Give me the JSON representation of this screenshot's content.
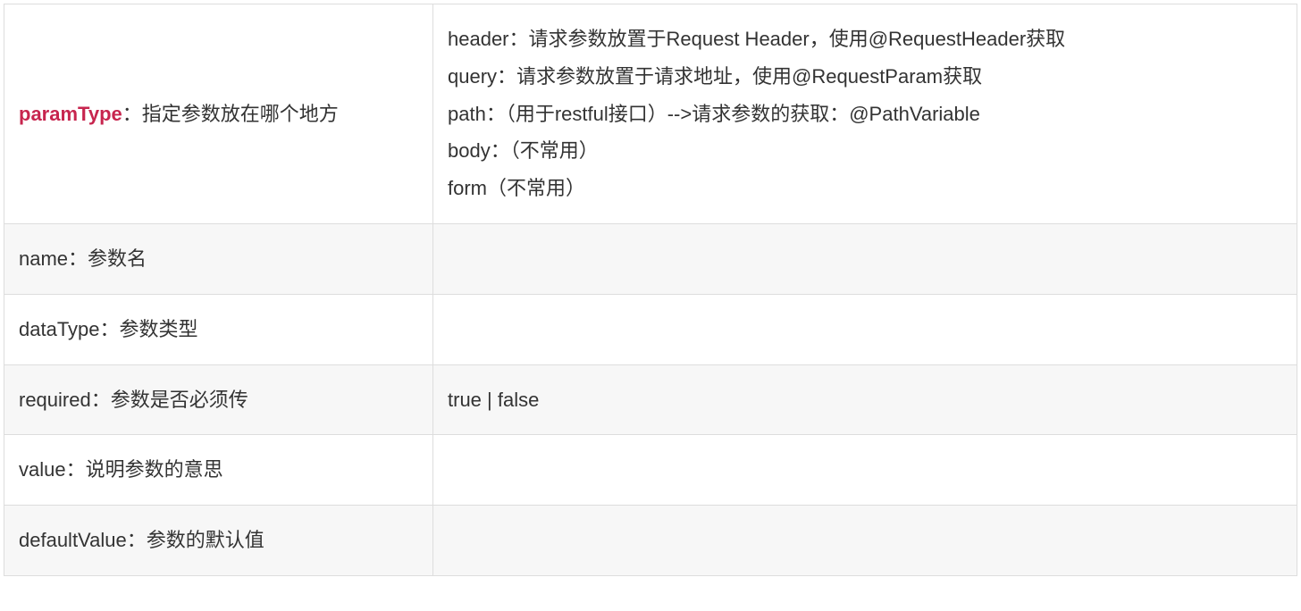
{
  "rows": [
    {
      "keyword": "paramType",
      "label_rest": "：指定参数放在哪个地方",
      "desc_lines": [
        "header：请求参数放置于Request Header，使用@RequestHeader获取",
        "query：请求参数放置于请求地址，使用@RequestParam获取",
        "path：（用于restful接口）-->请求参数的获取：@PathVariable",
        "body：（不常用）",
        "form（不常用）"
      ]
    },
    {
      "keyword": "",
      "label_rest": "name：参数名",
      "desc_lines": []
    },
    {
      "keyword": "",
      "label_rest": "dataType：参数类型",
      "desc_lines": []
    },
    {
      "keyword": "",
      "label_rest": "required：参数是否必须传",
      "desc_lines": [
        "true | false"
      ]
    },
    {
      "keyword": "",
      "label_rest": "value：说明参数的意思",
      "desc_lines": []
    },
    {
      "keyword": "",
      "label_rest": "defaultValue：参数的默认值",
      "desc_lines": []
    }
  ]
}
